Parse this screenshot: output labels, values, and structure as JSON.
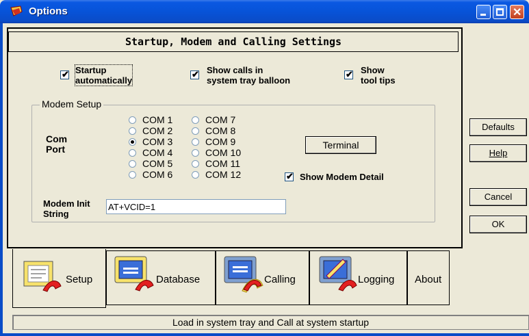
{
  "window": {
    "title": "Options",
    "header": "Startup, Modem and Calling Settings"
  },
  "checkboxes": {
    "startup_line1": "Startup",
    "startup_line2": "automatically",
    "balloon_line1": "Show calls in",
    "balloon_line2": "system tray balloon",
    "tooltips_line1": "Show",
    "tooltips_line2": "tool tips"
  },
  "modem": {
    "group_title": "Modem Setup",
    "com_label_1": "Com",
    "com_label_2": "Port",
    "ports_left": [
      "COM 1",
      "COM 2",
      "COM 3",
      "COM 4",
      "COM 5",
      "COM 6"
    ],
    "ports_right": [
      "COM 7",
      "COM 8",
      "COM 9",
      "COM 10",
      "COM 11",
      "COM 12"
    ],
    "selected_port": "COM 3",
    "terminal_label": "Terminal",
    "show_detail_label": "Show Modem Detail",
    "init_label_1": "Modem Init",
    "init_label_2": "String",
    "init_value": "AT+VCID=1"
  },
  "side_buttons": {
    "defaults": "Defaults",
    "help": "Help",
    "cancel": "Cancel",
    "ok": "OK"
  },
  "tabs": [
    {
      "label": "Setup",
      "icon": "setup-icon"
    },
    {
      "label": "Database",
      "icon": "database-icon"
    },
    {
      "label": "Calling",
      "icon": "calling-icon"
    },
    {
      "label": "Logging",
      "icon": "logging-icon"
    },
    {
      "label": "About",
      "icon": ""
    }
  ],
  "status_text": "Load in system tray and Call at system startup",
  "colors": {
    "titlebar": "#0a58e2",
    "face": "#ece9d8"
  }
}
